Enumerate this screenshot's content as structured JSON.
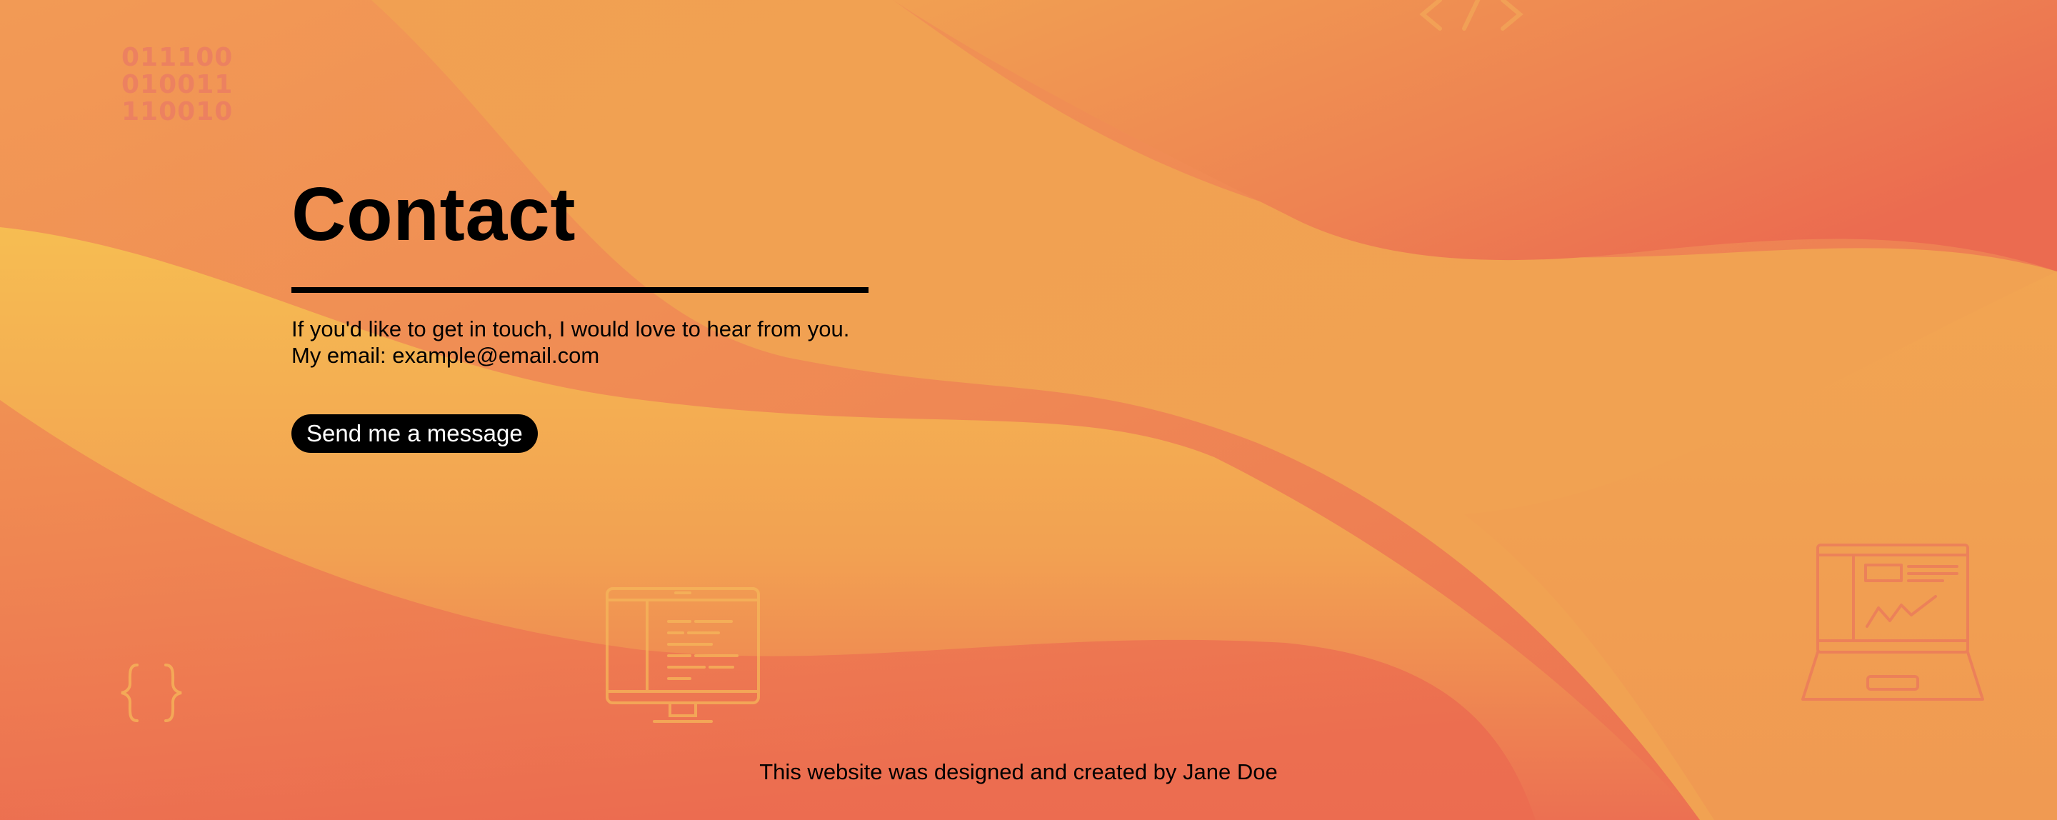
{
  "page": {
    "title": "Contact",
    "intro_line1": "If you'd like to get in touch, I would love to hear from you.",
    "intro_line2": "My email: example@email.com",
    "cta_label": "Send me a message",
    "footer": "This website was designed and created by Jane Doe"
  },
  "decorations": {
    "binary_lines": [
      "011100",
      "010011",
      "110010"
    ],
    "icons": [
      "binary-code-icon",
      "code-brackets-icon",
      "curly-braces-icon",
      "monitor-icon",
      "laptop-chart-icon"
    ]
  },
  "colors": {
    "background_light": "#f4ad50",
    "background_dark": "#ee7252",
    "text": "#000000",
    "button_bg": "#000000",
    "button_text": "#ffffff"
  }
}
